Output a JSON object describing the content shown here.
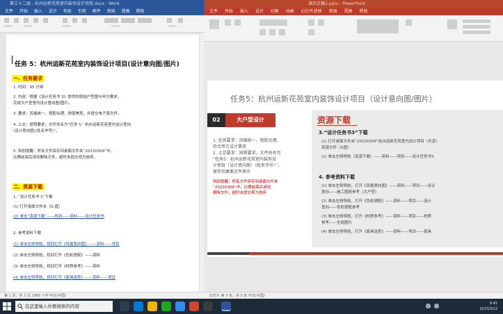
{
  "word": {
    "titlebar": "第三十二届 - 杭州运新花苑室内装饰设计项目.docx - Word",
    "menu": [
      "文件",
      "开始",
      "插入",
      "设计",
      "布局",
      "引用",
      "邮件",
      "审阅",
      "视图",
      "帮助"
    ],
    "statusbar": "第 1 页，共 3 页    1986 个字    中文(中国)",
    "title": "任务 5：杭州运新花苑室内装饰设计项目(设计意向图/图片)",
    "section1": "一、任务要求",
    "s1_lines": [
      "1. 时间：45 分钟",
      "2. 内容：根据《设计任务书 3》提供的原始户型图与甲方要求，",
      "   完成大户型室内设计意向图/图片。",
      "3. 要求：风格统一、搭配合理，排版美观，并提交电子版文件。",
      "4. 上交：按照要求，文件命名为“任务 5：杭州运新花苑室内设计意向",
      "   (设计意向图)(姓名学号)”。",
      "5. 特别提醒：所有文件保存到桌面文件夹“20230309”中，",
      "   比赛结束后请勿删除文件，超时未提交视为放弃。"
    ],
    "section2": "二、资源下载",
    "s2_lines": [
      "1. “设计任务书 3”下载",
      "   (1) 打开桌面文件夹（D 盘）",
      "   (2) 单击“资源下载”——找到——资料——设计任务书",
      "2. 参考资料下载",
      "   (1) 单击左侧导航，找到打开《风格意向图》——资料——项目",
      "   (2) 单击左侧导航，找到打开《色彩搭配》——资料",
      "   (3) 单击左侧导航，找到打开《材质参考》——资料",
      "   (4) 单击左侧导航，找到打开《家具选型》——资料——项目"
    ]
  },
  "ppt": {
    "titlebar": "演示文稿1.pptx - PowerPoint",
    "menu": [
      "文件",
      "开始",
      "插入",
      "设计",
      "切换",
      "动画",
      "幻灯片放映",
      "审阅",
      "视图",
      "帮助"
    ],
    "statusbar": "幻灯片 第 3 张，共 5 张    中文(中国)",
    "slide": {
      "title": "任务5：杭州运新花苑室内装饰设计项目（设计意向图/图片）",
      "tag_num": "02",
      "tag_label": "大户型设计",
      "left_lines": [
        "1. 任务要求：风格统一、搭配合理、",
        "   符合甲方设计需求",
        "2. 上交要求：按照要求，文件命名为",
        "   “任务5：杭州运新花苑室内装饰设",
        "   计项目（设计意向图）（姓名学号）”，",
        "   保存到桌面文件夹中"
      ],
      "left_red": [
        "特别提醒：所有文件保存到桌面文件夹",
        "“20230309”中，比赛结束后请勿",
        "删除文件，超时未提交视为放弃"
      ],
      "panel_title": "资源下载",
      "panel_h1": "3.“设计任务书3”下载",
      "panel_h1_lines": [
        "(1) 打开桌面文件夹“20230309”杭州运新花苑室内设计项目（共享）",
        "    资源文件（D盘）",
        "(2) 单击左侧导航（资源下载）——资料——项目——设计任务书3"
      ],
      "panel_h2": "4. 参考资料下载",
      "panel_h2_lines": [
        "(1) 单击左侧导航，打开《风格意向图》——资料——项目——设计",
        "    意向——施工图纸参考（大户型）",
        "(2) 单击左侧导航，打开《色彩搭配》——资料——项目——设计",
        "    意向——色彩搭配参考",
        "(3) 单击左侧导航，打开《材质参考》——资料——项目——材质",
        "    参考——全部图片",
        "(4) 单击左侧导航，打开《家具选型》——资料——项目——家具"
      ]
    }
  },
  "taskbar": {
    "search_placeholder": "在这里输入你要搜索的内容",
    "time": "9:45",
    "date": "2023/3/12"
  }
}
